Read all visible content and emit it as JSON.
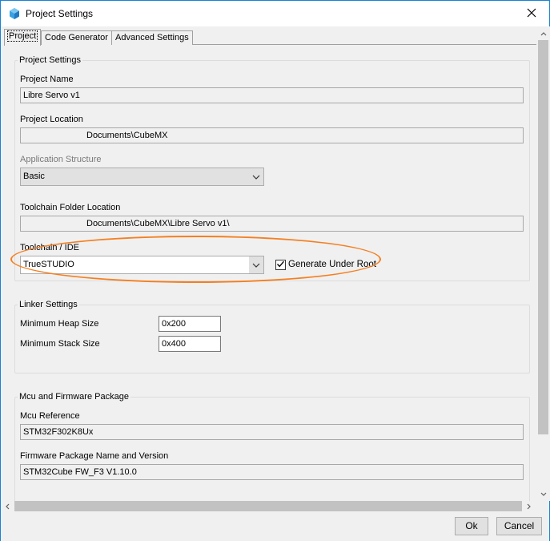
{
  "window": {
    "title": "Project Settings",
    "close_glyph": "✕"
  },
  "tabs": [
    {
      "label": "Project",
      "active": true
    },
    {
      "label": "Code Generator",
      "active": false
    },
    {
      "label": "Advanced Settings",
      "active": false
    }
  ],
  "project_settings": {
    "group_title": "Project Settings",
    "project_name_label": "Project Name",
    "project_name_value": "Libre Servo v1",
    "project_location_label": "Project Location",
    "project_location_value": "Documents\\CubeMX",
    "app_structure_label": "Application Structure",
    "app_structure_value": "Basic",
    "toolchain_folder_label": "Toolchain Folder Location",
    "toolchain_folder_value": "Documents\\CubeMX\\Libre Servo v1\\",
    "toolchain_ide_label": "Toolchain / IDE",
    "toolchain_ide_value": "TrueSTUDIO",
    "generate_under_root_label": "Generate Under Root",
    "generate_under_root_checked": true
  },
  "linker_settings": {
    "group_title": "Linker Settings",
    "min_heap_label": "Minimum Heap Size",
    "min_heap_value": "0x200",
    "min_stack_label": "Minimum Stack Size",
    "min_stack_value": "0x400"
  },
  "mcu_package": {
    "group_title": "Mcu and Firmware Package",
    "mcu_reference_label": "Mcu Reference",
    "mcu_reference_value": "STM32F302K8Ux",
    "fw_package_label": "Firmware Package Name and Version",
    "fw_package_value": "STM32Cube FW_F3 V1.10.0"
  },
  "buttons": {
    "ok_label": "Ok",
    "cancel_label": "Cancel"
  },
  "colors": {
    "highlight": "#f57f20",
    "window_border": "#1883d7",
    "app_icon": "#3aa0e0"
  },
  "icons": {
    "app": "cube-icon",
    "close": "close-icon",
    "dropdown": "chevron-down-icon",
    "check": "checkmark-icon"
  }
}
